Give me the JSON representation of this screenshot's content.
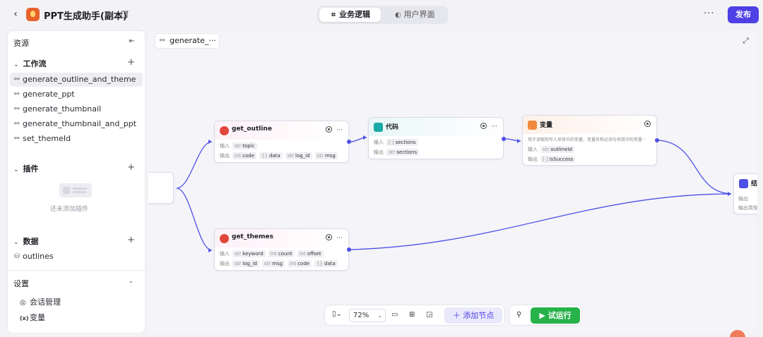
{
  "header": {
    "app_title": "PPT生成助手(副本)",
    "tabs": [
      {
        "label": "业务逻辑",
        "icon": "flow-icon"
      },
      {
        "label": "用户界面",
        "icon": "palette-icon"
      }
    ],
    "more_label": "···",
    "publish_label": "发布"
  },
  "sidebar": {
    "title": "资源",
    "workflow_section": "工作流",
    "workflows": [
      "generate_outline_and_theme",
      "generate_ppt",
      "generate_thumbnail",
      "generate_thumbnail_and_ppt",
      "set_themeId"
    ],
    "plugin_section": "插件",
    "plugin_empty": "还未添加插件",
    "data_section": "数据",
    "data_items": [
      "outlines"
    ],
    "settings_section": "设置",
    "settings_items": [
      {
        "label": "会话管理",
        "icon": "chat-icon"
      },
      {
        "label": "变量",
        "icon": "variable-icon"
      }
    ]
  },
  "canvas": {
    "tab_label": "generate_···",
    "colors": {
      "edge": "#4e4fe6",
      "accent": "#4e40e5",
      "run": "#27b24a"
    },
    "nodes": {
      "get_outline": {
        "name": "get_outline",
        "input_label": "输入",
        "inputs": [
          {
            "type": "str",
            "name": "topic"
          }
        ],
        "output_label": "输出",
        "outputs": [
          {
            "type": "int",
            "name": "code"
          },
          {
            "type": "{}",
            "name": "data"
          },
          {
            "type": "str",
            "name": "log_id"
          },
          {
            "type": "str",
            "name": "msg"
          }
        ]
      },
      "code": {
        "name": "代码",
        "input_label": "输入",
        "inputs": [
          {
            "type": "[·]",
            "name": "sections"
          }
        ],
        "output_label": "输出",
        "outputs": [
          {
            "type": "str",
            "name": "sections"
          }
        ]
      },
      "variable": {
        "name": "变量",
        "desc": "用于读取和写入项目中的变量，变量名称必须与项目中的变量···",
        "input_label": "输入",
        "inputs": [
          {
            "type": "str",
            "name": "outlineId"
          }
        ],
        "output_label": "输出",
        "outputs": [
          {
            "type": "[·]",
            "name": "isSuccess"
          }
        ]
      },
      "get_themes": {
        "name": "get_themes",
        "input_label": "输入",
        "inputs": [
          {
            "type": "str",
            "name": "keyword"
          },
          {
            "type": "int",
            "name": "count"
          },
          {
            "type": "int",
            "name": "offset"
          }
        ],
        "output_label": "输出",
        "outputs": [
          {
            "type": "str",
            "name": "log_id"
          },
          {
            "type": "str",
            "name": "msg"
          },
          {
            "type": "int",
            "name": "code"
          },
          {
            "type": "{}",
            "name": "data"
          }
        ]
      },
      "end": {
        "name": "结",
        "row1": "输出",
        "row2": "输出类型"
      }
    }
  },
  "toolbar": {
    "zoom": "72%",
    "add_node": "添加节点",
    "run": "试运行"
  }
}
